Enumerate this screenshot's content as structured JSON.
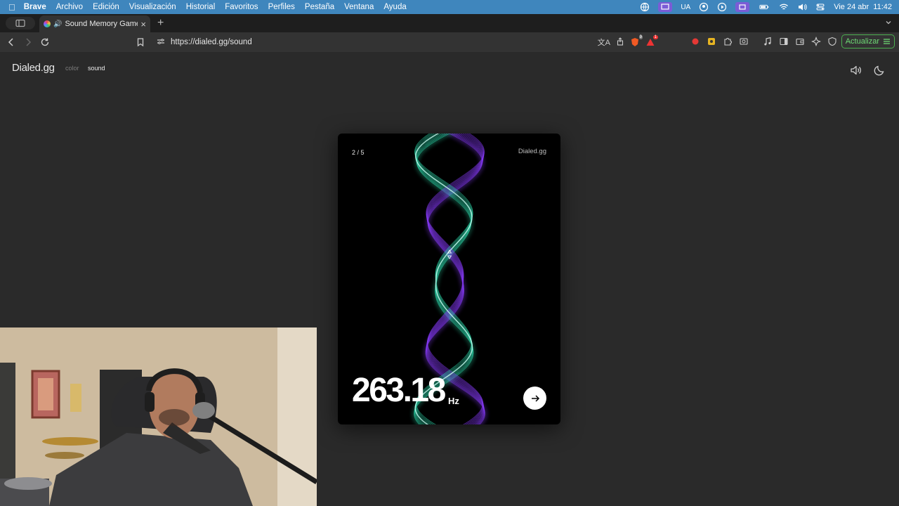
{
  "menubar": {
    "app": "Brave",
    "items": [
      "Archivo",
      "Edición",
      "Visualización",
      "Historial",
      "Favoritos",
      "Perfiles",
      "Pestaña",
      "Ventana",
      "Ayuda"
    ],
    "input_source": "UA",
    "datetime": "Vie 24 abr  11:42"
  },
  "tab": {
    "title": "Sound Memory Game — Ho"
  },
  "toolbar": {
    "url": "https://dialed.gg/sound",
    "update_label": "Actualizar",
    "shield_badge": "9",
    "rewards_badge": "1"
  },
  "page": {
    "brand": "Dialed.gg",
    "nav": {
      "color": "color",
      "sound": "sound"
    },
    "card": {
      "counter": "2 / 5",
      "brand": "Dialed.gg",
      "frequency": "263.18",
      "unit": "Hz"
    }
  },
  "colors": {
    "accent_teal": "#2fe0b0",
    "accent_purple": "#8a3cff",
    "menubar": "#3f86bd"
  }
}
